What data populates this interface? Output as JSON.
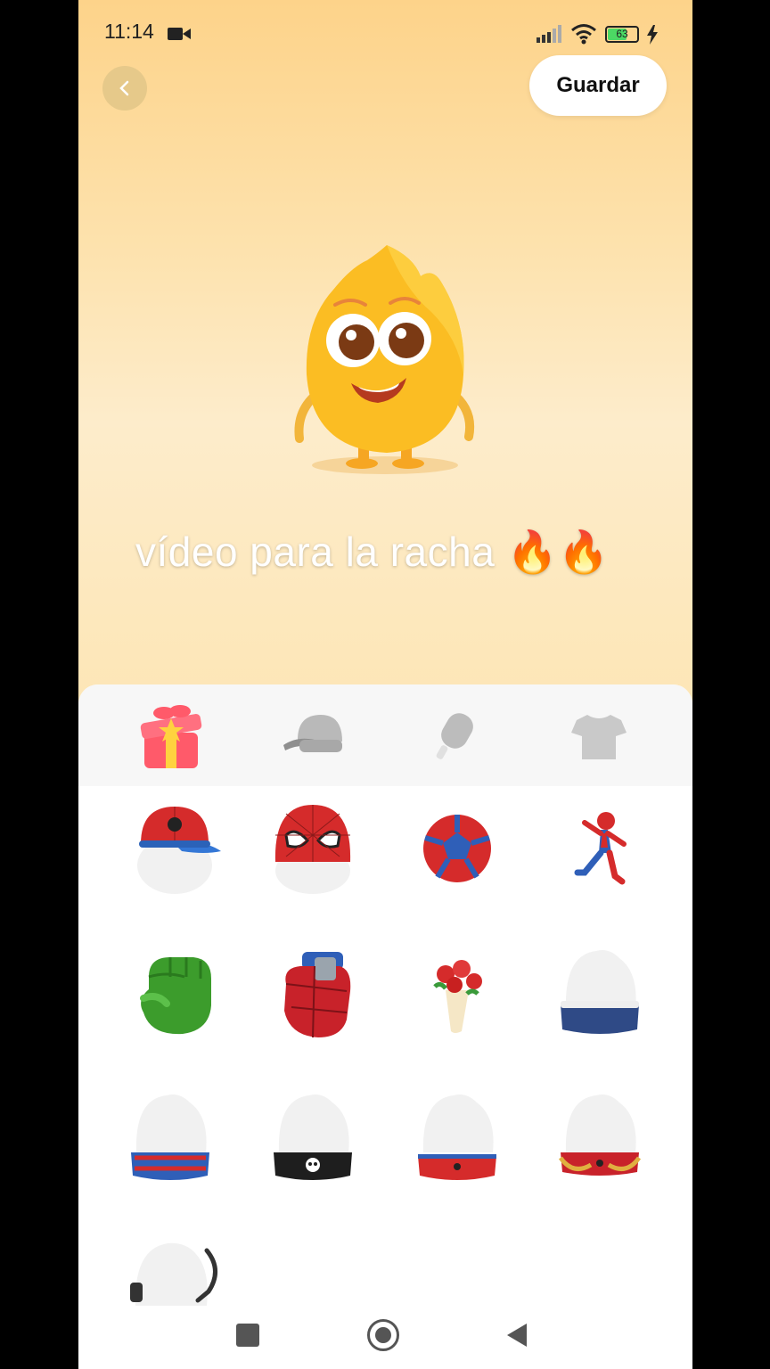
{
  "status_bar": {
    "time": "11:14",
    "battery": "63"
  },
  "header": {
    "save_label": "Guardar"
  },
  "caption": {
    "text": "vídeo para la racha 🔥🔥"
  },
  "tabs": [
    {
      "icon": "gift-icon"
    },
    {
      "icon": "cap-icon"
    },
    {
      "icon": "popsicle-icon"
    },
    {
      "icon": "tshirt-icon"
    }
  ],
  "items": [
    {
      "icon": "spiderman-cap-icon"
    },
    {
      "icon": "spiderman-mask-icon"
    },
    {
      "icon": "soccer-ball-icon"
    },
    {
      "icon": "spiderman-figure-icon"
    },
    {
      "icon": "green-fist-icon"
    },
    {
      "icon": "spiderman-glove-icon"
    },
    {
      "icon": "flower-bouquet-icon"
    },
    {
      "icon": "esu-headband-icon"
    },
    {
      "icon": "blue-red-headband-icon"
    },
    {
      "icon": "skull-headband-icon"
    },
    {
      "icon": "spider-headband-icon"
    },
    {
      "icon": "red-gold-headband-icon"
    },
    {
      "icon": "headset-icon"
    }
  ],
  "colors": {
    "background_top": "#fdd38a",
    "accent": "#f5a623",
    "panel": "#ffffff"
  }
}
